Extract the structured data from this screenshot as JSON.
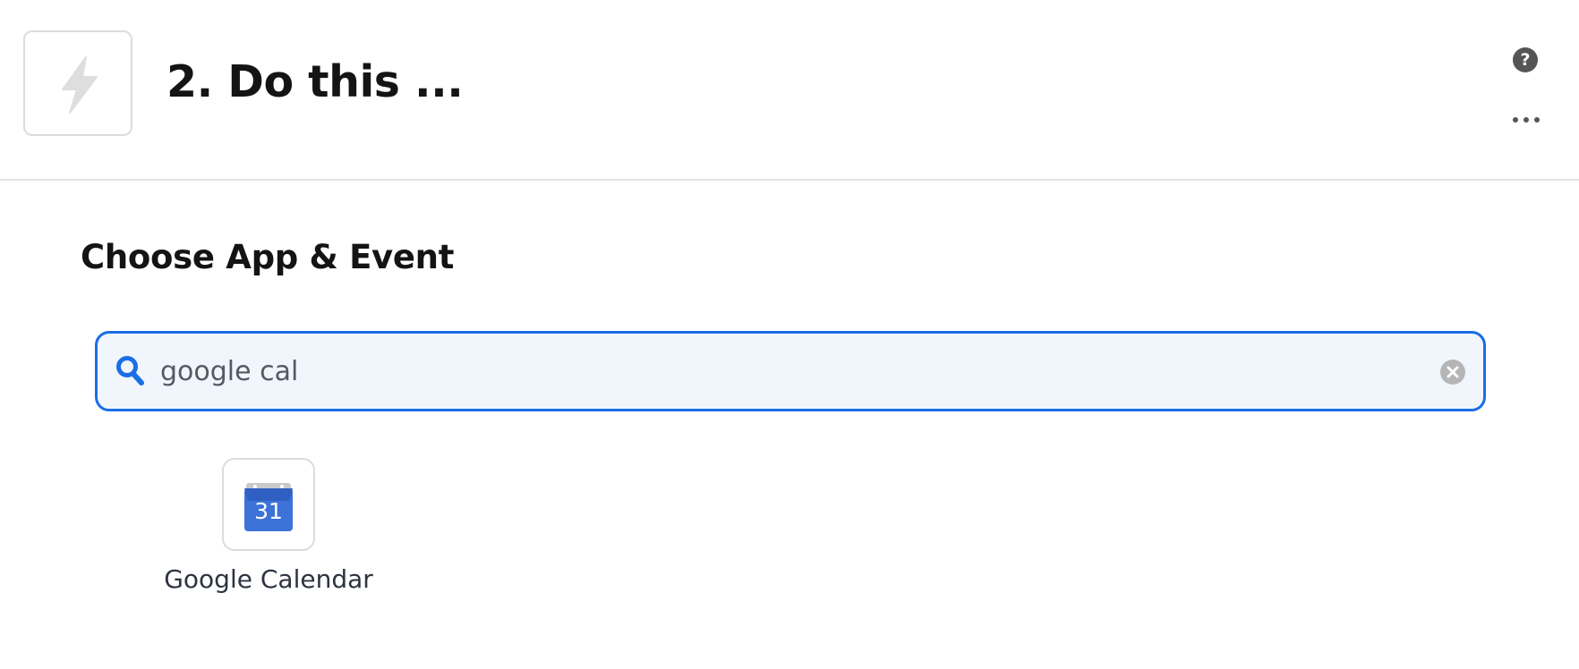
{
  "header": {
    "step_title": "2. Do this ...",
    "step_icon": "lightning-bolt-icon",
    "help_icon": "question-mark-icon",
    "help_glyph": "?",
    "more_icon": "ellipsis-icon"
  },
  "main": {
    "section_title": "Choose App & Event",
    "search": {
      "value": "google cal",
      "icon": "search-icon",
      "clear_icon": "clear-circle-icon"
    },
    "results": [
      {
        "label": "Google Calendar",
        "icon": "google-calendar-icon",
        "icon_text": "31"
      }
    ]
  },
  "colors": {
    "accent": "#1a6ee6",
    "search_background": "#f1f6fd",
    "calendar_blue": "#3d73d8"
  }
}
